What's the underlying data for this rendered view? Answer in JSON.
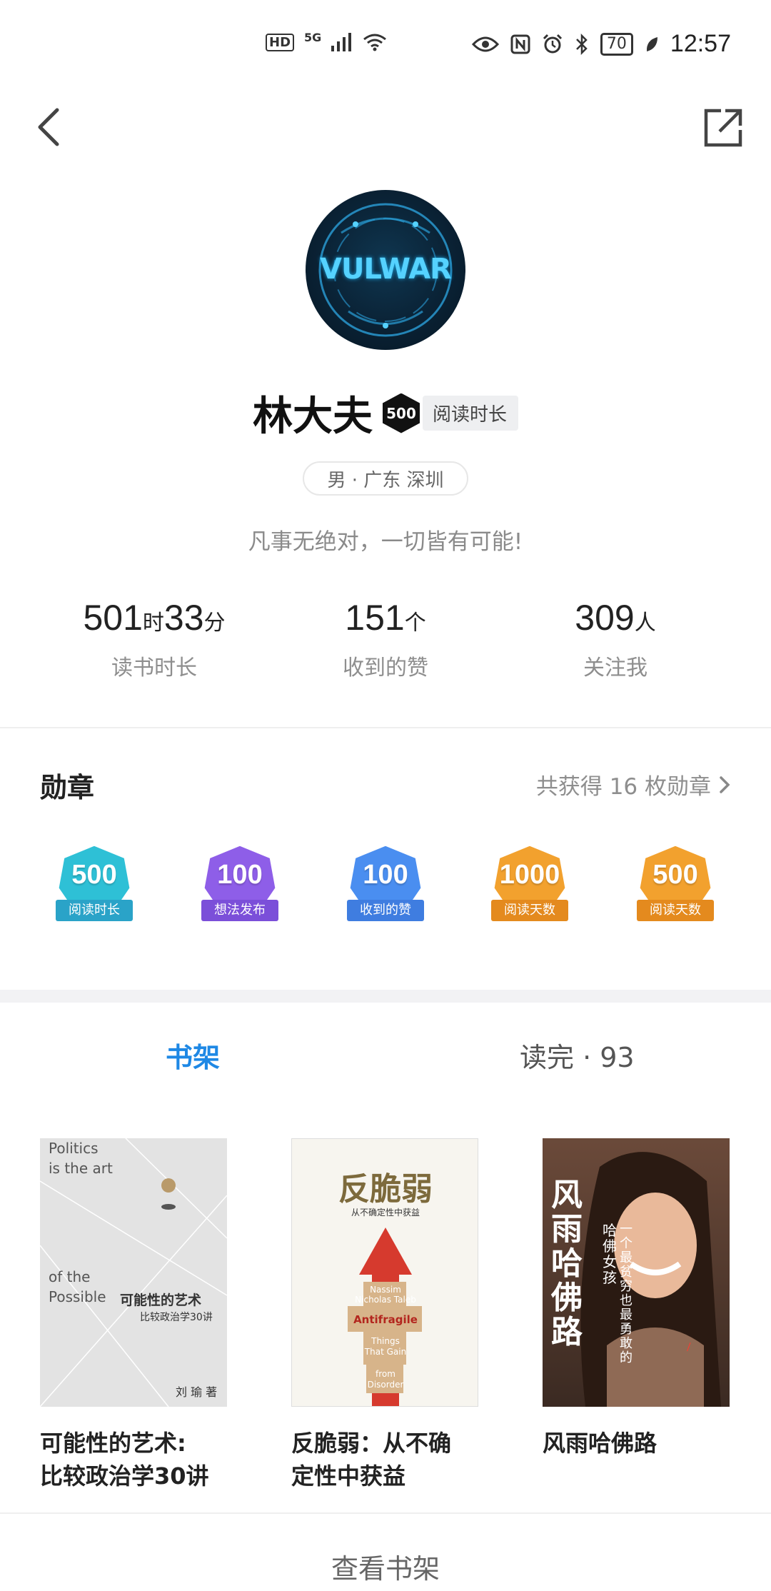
{
  "status_bar": {
    "hd": "HD",
    "network": "5G",
    "battery": "70",
    "time": "12:57"
  },
  "profile": {
    "avatar_text": "VULWAR",
    "name": "林大夫",
    "badge_number": "500",
    "badge_label": "阅读时长",
    "location": "男 · 广东 深圳",
    "signature": "凡事无绝对，一切皆有可能!"
  },
  "stats": [
    {
      "value1": "501",
      "unit1": "时",
      "value2": "33",
      "unit2": "分",
      "label": "读书时长"
    },
    {
      "value1": "151",
      "unit1": "个",
      "label": "收到的赞"
    },
    {
      "value1": "309",
      "unit1": "人",
      "label": "关注我"
    }
  ],
  "medals": {
    "title": "勋章",
    "summary": "共获得 16 枚勋章",
    "items": [
      {
        "number": "500",
        "label": "阅读时长",
        "color": "#2ec0d6",
        "ribbon": "#2aa3c8"
      },
      {
        "number": "100",
        "label": "想法发布",
        "color": "#8e5ee8",
        "ribbon": "#7b4fd9"
      },
      {
        "number": "100",
        "label": "收到的赞",
        "color": "#4a8ef0",
        "ribbon": "#3f7de0"
      },
      {
        "number": "1000",
        "label": "阅读天数",
        "color": "#f2a12e",
        "ribbon": "#e48a1e"
      },
      {
        "number": "500",
        "label": "阅读天数",
        "color": "#f2a12e",
        "ribbon": "#e48a1e"
      }
    ]
  },
  "tabs": [
    {
      "label": "书架"
    },
    {
      "label": "读完 · 93"
    }
  ],
  "books": [
    {
      "title_line1": "可能性的艺术:",
      "title_line2": "比较政治学30讲",
      "cover": {
        "line1": "Politics",
        "line2": "is the art",
        "line3": "of the",
        "line4": "Possible",
        "cn_title": "可能性的艺术",
        "cn_sub": "比较政治学30讲",
        "author": "刘 瑜 著"
      }
    },
    {
      "title_line1": "反脆弱：从不确",
      "title_line2": "定性中获益",
      "cover": {
        "cn_title": "反脆弱",
        "cn_sub": "从不确定性中获益",
        "en1": "Nassim",
        "en2": "Nicholas Taleb",
        "en3": "Antifragile",
        "en4": "Things",
        "en5": "That Gain",
        "en6": "from",
        "en7": "Disorder"
      }
    },
    {
      "title_line1": "风雨哈佛路",
      "title_line2": "",
      "cover": {
        "cn_title": "风雨哈佛路",
        "sub": "哈佛女孩",
        "sub2": "一个最贫穷也最勇敢的"
      }
    }
  ],
  "footer": {
    "view_shelf": "查看书架"
  }
}
